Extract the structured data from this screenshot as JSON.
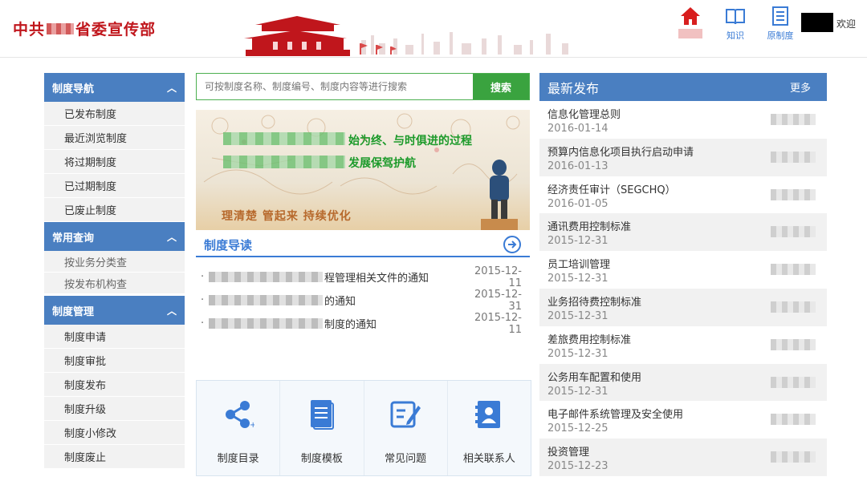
{
  "header": {
    "brand_left": "中共",
    "brand_right": "省委宣传部",
    "nav": [
      {
        "icon": "home-icon",
        "label": ""
      },
      {
        "icon": "book-icon",
        "label": "知识"
      },
      {
        "icon": "document-list-icon",
        "label": "原制度"
      }
    ],
    "welcome": "欢迎"
  },
  "sidebar": {
    "sections": [
      {
        "title": "制度导航",
        "items": [
          "已发布制度",
          "最近浏览制度",
          "将过期制度",
          "已过期制度",
          "已废止制度"
        ]
      },
      {
        "title": "常用查询",
        "items": [
          "按业务分类查",
          "按发布机构查"
        ]
      },
      {
        "title": "制度管理",
        "items": [
          "制度申请",
          "制度审批",
          "制度发布",
          "制度升级",
          "制度小修改",
          "制度废止"
        ]
      }
    ]
  },
  "search": {
    "placeholder": "可按制度名称、制度编号、制度内容等进行搜索",
    "button": "搜索"
  },
  "hero": {
    "line1": "始为终、与时俱进的过程",
    "line2": "发展保驾护航",
    "slogan": "理清楚  管起来  持续优化"
  },
  "guide": {
    "title": "制度导读",
    "items": [
      {
        "title": "程管理相关文件的通知",
        "date": "2015-12-11"
      },
      {
        "title": "的通知",
        "date": "2015-12-31"
      },
      {
        "title": "制度的通知",
        "date": "2015-12-11"
      }
    ]
  },
  "quick": [
    {
      "icon": "share-icon",
      "label": "制度目录"
    },
    {
      "icon": "document-icon",
      "label": "制度模板"
    },
    {
      "icon": "edit-icon",
      "label": "常见问题"
    },
    {
      "icon": "contacts-icon",
      "label": "相关联系人"
    }
  ],
  "latest": {
    "title": "最新发布",
    "more": "更多",
    "items": [
      {
        "title": "信息化管理总则",
        "date": "2016-01-14"
      },
      {
        "title": "预算内信息化项目执行启动申请",
        "date": "2016-01-13"
      },
      {
        "title": "经济责任审计（SEGCHQ）",
        "date": "2016-01-05"
      },
      {
        "title": "通讯费用控制标准",
        "date": "2015-12-31"
      },
      {
        "title": "员工培训管理",
        "date": "2015-12-31"
      },
      {
        "title": "业务招待费控制标准",
        "date": "2015-12-31"
      },
      {
        "title": "差旅费用控制标准",
        "date": "2015-12-31"
      },
      {
        "title": "公务用车配置和使用",
        "date": "2015-12-31"
      },
      {
        "title": "电子邮件系统管理及安全使用",
        "date": "2015-12-25"
      },
      {
        "title": "投资管理",
        "date": "2015-12-23"
      }
    ]
  },
  "colors": {
    "brand_red": "#c0161c",
    "primary_blue": "#4a7fc1",
    "search_green": "#3aa33f"
  }
}
